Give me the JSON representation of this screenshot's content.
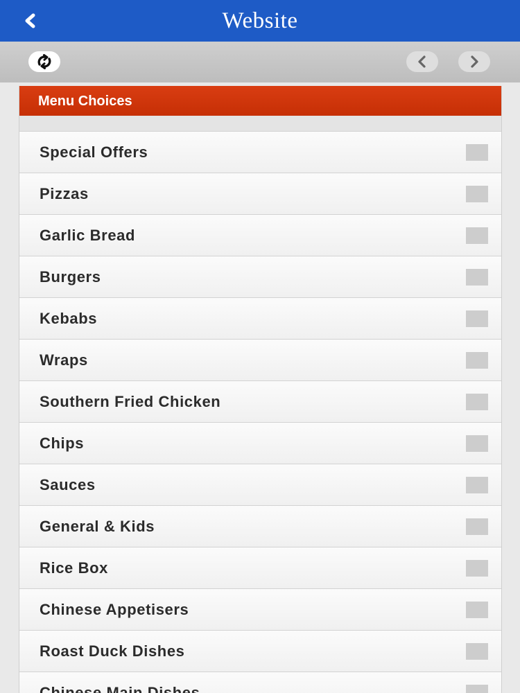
{
  "header": {
    "title": "Website",
    "back_icon": "chevron-left-icon"
  },
  "toolbar": {
    "refresh_icon": "refresh-icon",
    "prev_icon": "chevron-left-icon",
    "next_icon": "chevron-right-icon"
  },
  "panel": {
    "title": "Menu Choices"
  },
  "menu": {
    "items": [
      {
        "label": "Special Offers"
      },
      {
        "label": "Pizzas"
      },
      {
        "label": "Garlic Bread"
      },
      {
        "label": "Burgers"
      },
      {
        "label": "Kebabs"
      },
      {
        "label": "Wraps"
      },
      {
        "label": "Southern Fried Chicken"
      },
      {
        "label": "Chips"
      },
      {
        "label": "Sauces"
      },
      {
        "label": "General & Kids"
      },
      {
        "label": "Rice Box"
      },
      {
        "label": "Chinese Appetisers"
      },
      {
        "label": "Roast Duck Dishes"
      },
      {
        "label": "Chinese Main Dishes"
      }
    ]
  },
  "colors": {
    "header_blue": "#1e5bc6",
    "panel_header_orange": "#cf3508",
    "toolbar_gray": "#c6c6c6"
  }
}
